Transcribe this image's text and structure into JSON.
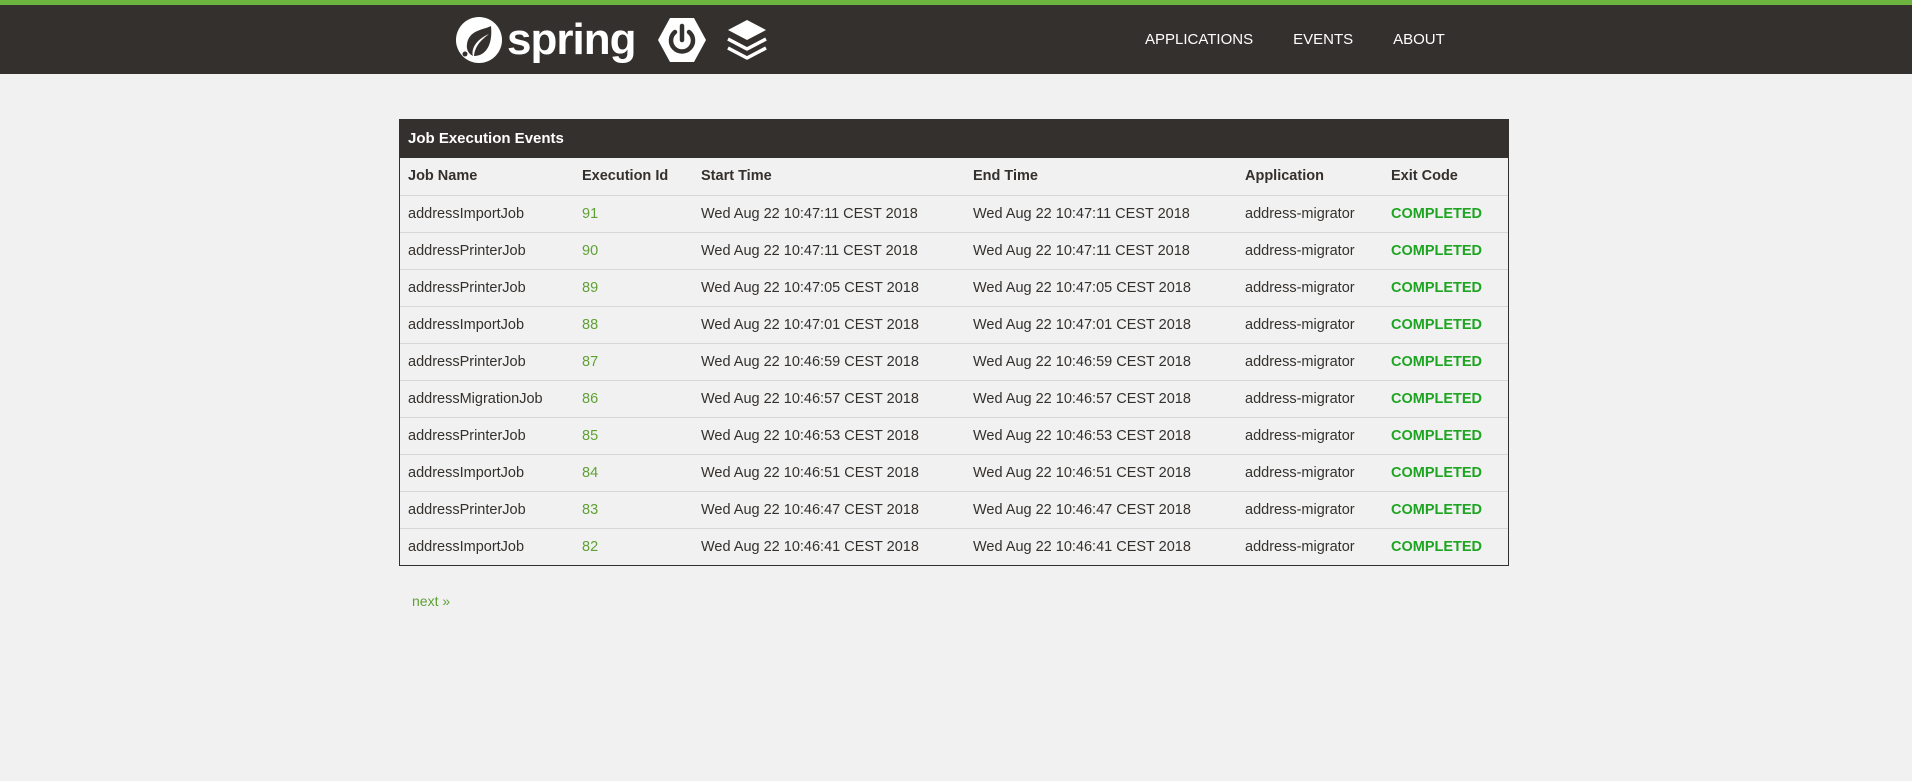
{
  "header": {
    "brand_text": "spring",
    "nav": [
      {
        "label": "APPLICATIONS"
      },
      {
        "label": "EVENTS"
      },
      {
        "label": "ABOUT"
      }
    ]
  },
  "panel": {
    "title": "Job Execution Events",
    "columns": [
      "Job Name",
      "Execution Id",
      "Start Time",
      "End Time",
      "Application",
      "Exit Code"
    ],
    "rows": [
      {
        "job": "addressImportJob",
        "id": "91",
        "start": "Wed Aug 22 10:47:11 CEST 2018",
        "end": "Wed Aug 22 10:47:11 CEST 2018",
        "app": "address-migrator",
        "exit": "COMPLETED"
      },
      {
        "job": "addressPrinterJob",
        "id": "90",
        "start": "Wed Aug 22 10:47:11 CEST 2018",
        "end": "Wed Aug 22 10:47:11 CEST 2018",
        "app": "address-migrator",
        "exit": "COMPLETED"
      },
      {
        "job": "addressPrinterJob",
        "id": "89",
        "start": "Wed Aug 22 10:47:05 CEST 2018",
        "end": "Wed Aug 22 10:47:05 CEST 2018",
        "app": "address-migrator",
        "exit": "COMPLETED"
      },
      {
        "job": "addressImportJob",
        "id": "88",
        "start": "Wed Aug 22 10:47:01 CEST 2018",
        "end": "Wed Aug 22 10:47:01 CEST 2018",
        "app": "address-migrator",
        "exit": "COMPLETED"
      },
      {
        "job": "addressPrinterJob",
        "id": "87",
        "start": "Wed Aug 22 10:46:59 CEST 2018",
        "end": "Wed Aug 22 10:46:59 CEST 2018",
        "app": "address-migrator",
        "exit": "COMPLETED"
      },
      {
        "job": "addressMigrationJob",
        "id": "86",
        "start": "Wed Aug 22 10:46:57 CEST 2018",
        "end": "Wed Aug 22 10:46:57 CEST 2018",
        "app": "address-migrator",
        "exit": "COMPLETED"
      },
      {
        "job": "addressPrinterJob",
        "id": "85",
        "start": "Wed Aug 22 10:46:53 CEST 2018",
        "end": "Wed Aug 22 10:46:53 CEST 2018",
        "app": "address-migrator",
        "exit": "COMPLETED"
      },
      {
        "job": "addressImportJob",
        "id": "84",
        "start": "Wed Aug 22 10:46:51 CEST 2018",
        "end": "Wed Aug 22 10:46:51 CEST 2018",
        "app": "address-migrator",
        "exit": "COMPLETED"
      },
      {
        "job": "addressPrinterJob",
        "id": "83",
        "start": "Wed Aug 22 10:46:47 CEST 2018",
        "end": "Wed Aug 22 10:46:47 CEST 2018",
        "app": "address-migrator",
        "exit": "COMPLETED"
      },
      {
        "job": "addressImportJob",
        "id": "82",
        "start": "Wed Aug 22 10:46:41 CEST 2018",
        "end": "Wed Aug 22 10:46:41 CEST 2018",
        "app": "address-migrator",
        "exit": "COMPLETED"
      }
    ]
  },
  "pagination": {
    "next_label": "next »"
  },
  "colors": {
    "header_bg": "#34302d",
    "accent_green": "#6db33f",
    "link_green": "#5fa134",
    "status_green": "#1da522"
  },
  "icons": [
    "spring-leaf-icon",
    "spring-boot-power-icon",
    "stack-layers-icon"
  ]
}
